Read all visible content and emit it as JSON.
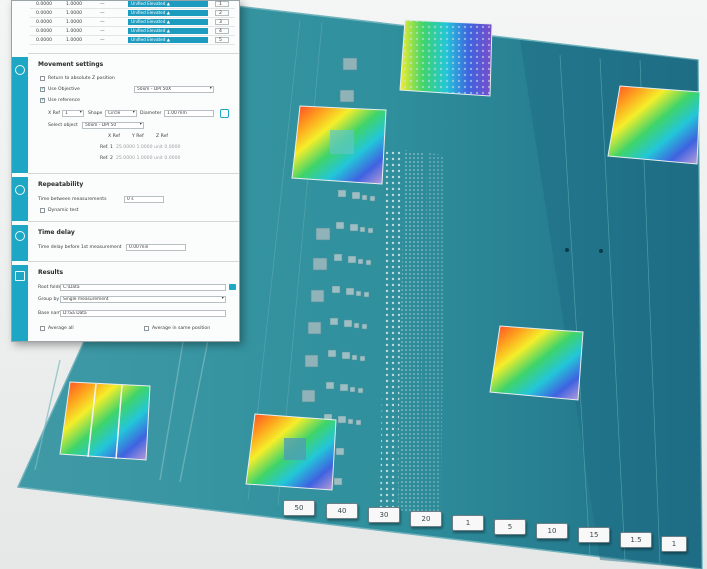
{
  "colors": {
    "accent": "#1da7c4",
    "wafer": "#2f8c96"
  },
  "table_rows": [
    {
      "col_a": "0.0000",
      "col_b": "1.0000",
      "col_c": "—",
      "badge": "Unified Elevated ▲",
      "spin": "1"
    },
    {
      "col_a": "0.0000",
      "col_b": "1.0000",
      "col_c": "—",
      "badge": "Unified Elevated ▲",
      "spin": "2"
    },
    {
      "col_a": "0.0000",
      "col_b": "1.0000",
      "col_c": "—",
      "badge": "Unified Elevated ▲",
      "spin": "3"
    },
    {
      "col_a": "0.0000",
      "col_b": "1.0000",
      "col_c": "—",
      "badge": "Unified Elevated ▲",
      "spin": "4"
    },
    {
      "col_a": "0.0000",
      "col_b": "1.0000",
      "col_c": "—",
      "badge": "Unified Elevated ▲",
      "spin": "5"
    }
  ],
  "movement": {
    "title": "Movement settings",
    "return_label": "Return to absolute Z position",
    "use_objective_label": "Use Objective",
    "objective_value": "50xm - DPI 50X",
    "use_reference_label": "Use reference",
    "x_ref_label": "X Ref",
    "x_ref_value": "1",
    "shape_label": "Shape",
    "shape_value": "Circle",
    "diameter_label": "Diameter",
    "diameter_value": "1.00 mm",
    "select_object_label": "Select object",
    "select_object_value": "50xm - DPI 50",
    "axis_x": "X Ref",
    "axis_y": "Y Ref",
    "axis_z": "Z Ref",
    "ref1_label": "Ref. 1",
    "ref1_values": "25.0000   1.0000   unit 0.0000",
    "ref2_label": "Ref. 2",
    "ref2_values": "25.0000   1.0000   unit 0.0000"
  },
  "repeatability": {
    "title": "Repeatability",
    "time_label": "Time between measurements",
    "time_value": "0 s",
    "dynamic_label": "Dynamic test"
  },
  "time_delay": {
    "title": "Time delay",
    "delay_label": "Time delay before 1st measurement",
    "delay_value": "0.00 min"
  },
  "results": {
    "title": "Results",
    "root_folder_label": "Root folder",
    "root_folder_value": "C:\\Data",
    "group_label": "Group by",
    "group_value": "Single measurement",
    "base_name_label": "Base name",
    "base_name_value": "D:\\Sa Data",
    "average_all_label": "Average all",
    "average_same_label": "Average in same position"
  },
  "wafer_labels": [
    "50",
    "40",
    "30",
    "20",
    "1",
    "5",
    "10",
    "15",
    "1.5",
    "1"
  ]
}
